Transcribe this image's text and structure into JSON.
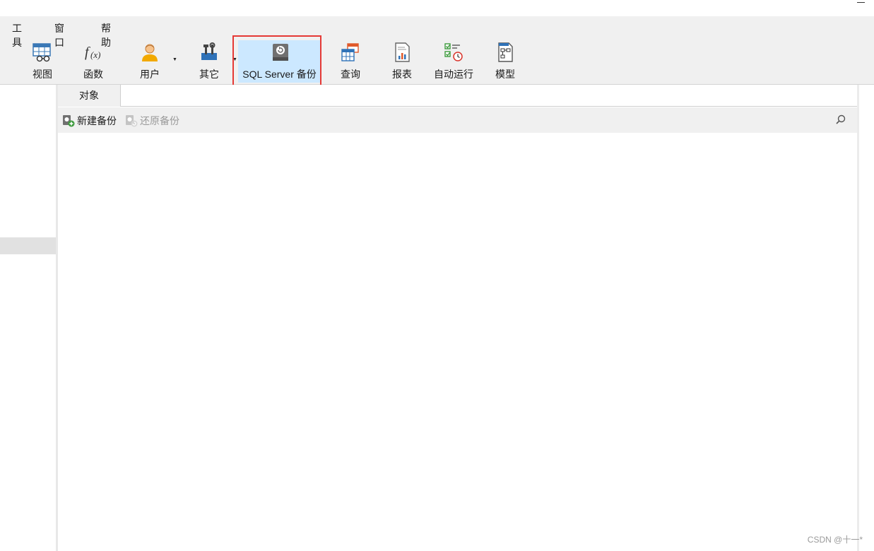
{
  "menu": [
    "工具",
    "窗口",
    "帮助"
  ],
  "toolbar": {
    "view": "视图",
    "function": "函数",
    "user": "用户",
    "other": "其它",
    "backup": "SQL Server 备份",
    "query": "查询",
    "report": "报表",
    "autorun": "自动运行",
    "model": "模型"
  },
  "tabs": {
    "objects": "对象"
  },
  "actions": {
    "new_backup": "新建备份",
    "restore_backup": "还原备份"
  },
  "watermark": "CSDN @十一*",
  "colors": {
    "active_tool_bg": "#cce8ff",
    "highlight_border": "#e53935"
  }
}
